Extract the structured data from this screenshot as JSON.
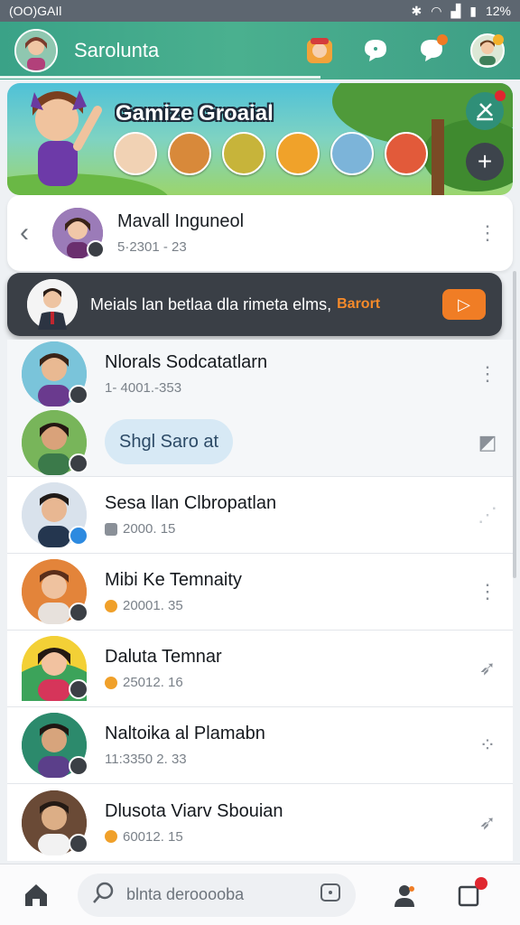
{
  "status_bar": {
    "left": "(OO)GAIl",
    "time": "12%"
  },
  "app_bar": {
    "title": "Sarolunta"
  },
  "banner": {
    "title": "Gamize Groaial"
  },
  "pinned_chat": {
    "name": "Mavall Inguneol",
    "sub": "5·2301 - 23"
  },
  "announcement": {
    "text": "Meials lan betlaa dla rimeta elms,",
    "highlight": "Barort"
  },
  "chats": [
    {
      "name": "Nlorals Sodcatatlarn",
      "sub": "1- 4001.-353"
    },
    {
      "chip": "Shgl Saro at"
    },
    {
      "name": "Sesa llan Clbropatlan",
      "sub": "2000. 15"
    },
    {
      "name": "Mibi Ke Temnaity",
      "sub": "20001. 35"
    },
    {
      "name": "Daluta Temnar",
      "sub": "25012. 16"
    },
    {
      "name": "Naltoika al Plamabn",
      "sub": "11:3350 2. 33"
    },
    {
      "name": "Dlusota Viarv Sbouian",
      "sub": "60012. 15"
    }
  ],
  "bottom_nav": {
    "search_placeholder": "blnta derooooba"
  },
  "colors": {
    "accent": "#3aa287",
    "announcement_accent": "#f07d25",
    "badge": "#e0262f"
  }
}
